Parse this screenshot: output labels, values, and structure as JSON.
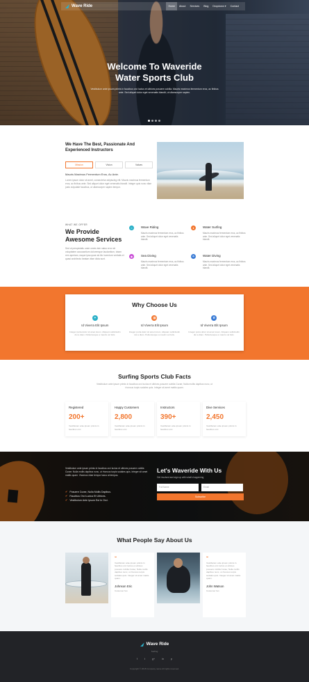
{
  "brand": {
    "name": "Wave Ride",
    "footer_tagline": "Surfing"
  },
  "nav": {
    "items": [
      {
        "label": "Home",
        "active": true
      },
      {
        "label": "About",
        "active": false
      },
      {
        "label": "Services",
        "active": false
      },
      {
        "label": "Blog",
        "active": false
      },
      {
        "label": "Dropdown ▾",
        "active": false
      },
      {
        "label": "Contact",
        "active": false
      }
    ]
  },
  "hero": {
    "title_line1": "Welcome To Waveride",
    "title_line2": "Water Sports Club",
    "subtitle": "Vestibulum ante ipsum primis in faucibus orci luctus et ultrices posuere cubilia. Mauris maximus fermentum eros, ac finibus ante. Sed aliquet dolor eget venenatis blandit, ut ullamcorper sapien."
  },
  "about": {
    "heading": "We Have The Best, Passionate And Experienced Instructors",
    "tabs": [
      "Mission",
      "Vision",
      "Values"
    ],
    "subheading": "Mauris Maximus Fermentum Eros, Ac Ante.",
    "paragraph": "Lorem ipsum dolor sit amet, consectetur adipiscing elit. Mauris maximus fermentum eros, ac finibus ante. Sed aliquet dolor eget venenatis blandit. Integer quis nunc vitae justo vulputate faucibus, ut ullamcorper sapien tempor."
  },
  "services": {
    "kicker": "What We Offer",
    "title": "We Provide Awesome Services",
    "text": "Sed ut perspiciatis unde omnis iste natus error sit voluptatem accusantium doloremque laudantium, totam rem aperiam, eaque ipsa quae ab illo inventore veritatis et quasi architecto beatae vitae dicta sunt.",
    "items": [
      {
        "name": "Wave Riding",
        "icon": "wave-icon",
        "color": "#2bb0c8",
        "desc": "Mauris maximus fermentum eros, ac finibus ante. Sed aliquet dolor eget venenatis blandit."
      },
      {
        "name": "Water Surfing",
        "icon": "surfboard-icon",
        "color": "#f2762e",
        "desc": "Mauris maximus fermentum eros, ac finibus ante. Sed aliquet dolor eget venenatis blandit."
      },
      {
        "name": "Sea Diving",
        "icon": "diving-mask-icon",
        "color": "#c84bd6",
        "desc": "Mauris maximus fermentum eros, ac finibus ante. Sed aliquet dolor eget venenatis blandit."
      },
      {
        "name": "Water Diving",
        "icon": "umbrella-icon",
        "color": "#3a7bd5",
        "desc": "Mauris maximus fermentum eros, ac finibus ante. Sed aliquet dolor eget venenatis blandit."
      }
    ]
  },
  "why": {
    "title": "Why Choose Us",
    "items": [
      {
        "title": "Id Viverra Elit Ipsum",
        "icon": "compass-icon",
        "color": "#2bb0c8",
        "desc": "Integer porta dolor sit amet lorem. Aliquam sollicitudin dui a diam. Pellentesque a mauris vel felis."
      },
      {
        "title": "Id Viverra Elit Ipsum",
        "icon": "calendar-icon",
        "color": "#f2762e",
        "desc": "Integer porta dolor sit amet lorem. Aliquam sollicitudin dui a diam. Pellentesque a mauris vel felis."
      },
      {
        "title": "Id Viverra Elit Ipsum",
        "icon": "trophy-icon",
        "color": "#3a7bd5",
        "desc": "Integer porta dolor sit amet lorem. Aliquam sollicitudin dui a diam. Pellentesque a mauris vel felis."
      }
    ]
  },
  "facts": {
    "title": "Surfing Sports Club Facts",
    "intro": "Vestibulum ante ipsum primis in faucibus orci luctus et ultrices posuere cubilia Curae; Nulla mollis dapibus nunc, ut rhoncus turpis sodales quis. Integer sit amet mattis quam.",
    "items": [
      {
        "label": "Registered",
        "value": "200+",
        "desc": "Vestibulum ante ipsum primis in faucibus orci."
      },
      {
        "label": "Happy Customers",
        "value": "2,800",
        "desc": "Vestibulum ante ipsum primis in faucibus orci."
      },
      {
        "label": "Instructors",
        "value": "390+",
        "desc": "Vestibulum ante ipsum primis in faucibus orci."
      },
      {
        "label": "Dive Services",
        "value": "2,450",
        "desc": "Vestibulum ante ipsum primis in faucibus orci."
      }
    ]
  },
  "contact": {
    "left_text": "Vestibulum ante ipsum primis in faucibus orci luctus et ultrices posuere cubilia Curae; Nulla mollis dapibus nunc, ut rhoncus turpis sodales quis. Integer sit amet mattis quam. Vivamus vitae tempor lacus at tempus.",
    "bullets": [
      "Posuere Curae, Nulla Mollis Dapibus.",
      "Faucibus Orci Luctus Et Ultrices.",
      "Vestibulum Ante Ipsum Est In Orci."
    ],
    "title": "Let's Waveride With Us",
    "subtitle": "Get involved and sign up with what's happening",
    "name_placeholder": "Full Name",
    "email_placeholder": "Email",
    "button": "Subscribe"
  },
  "testimonials": {
    "title": "What People Say About Us",
    "items": [
      {
        "quote": "Vestibulum ante ipsum primis in faucibus orci luctus et ultrices posuere cubilia Curae; Nulla mollis dapibus nunc, ut rhoncus turpis sodales quis. Integer sit amet mattis quam.",
        "name": "Johnson Eric",
        "role": "Customer fan"
      },
      {
        "quote": "Vestibulum ante ipsum primis in faucibus orci luctus et ultrices posuere cubilia Curae; Nulla mollis dapibus nunc, ut rhoncus turpis sodales quis. Integer sit amet mattis quam.",
        "name": "John Watson",
        "role": "Customer fan"
      }
    ]
  },
  "footer": {
    "social": [
      "f",
      "t",
      "g+",
      "in",
      "p"
    ],
    "copyright": "Copyright © 2018 Company name All rights reserved."
  }
}
